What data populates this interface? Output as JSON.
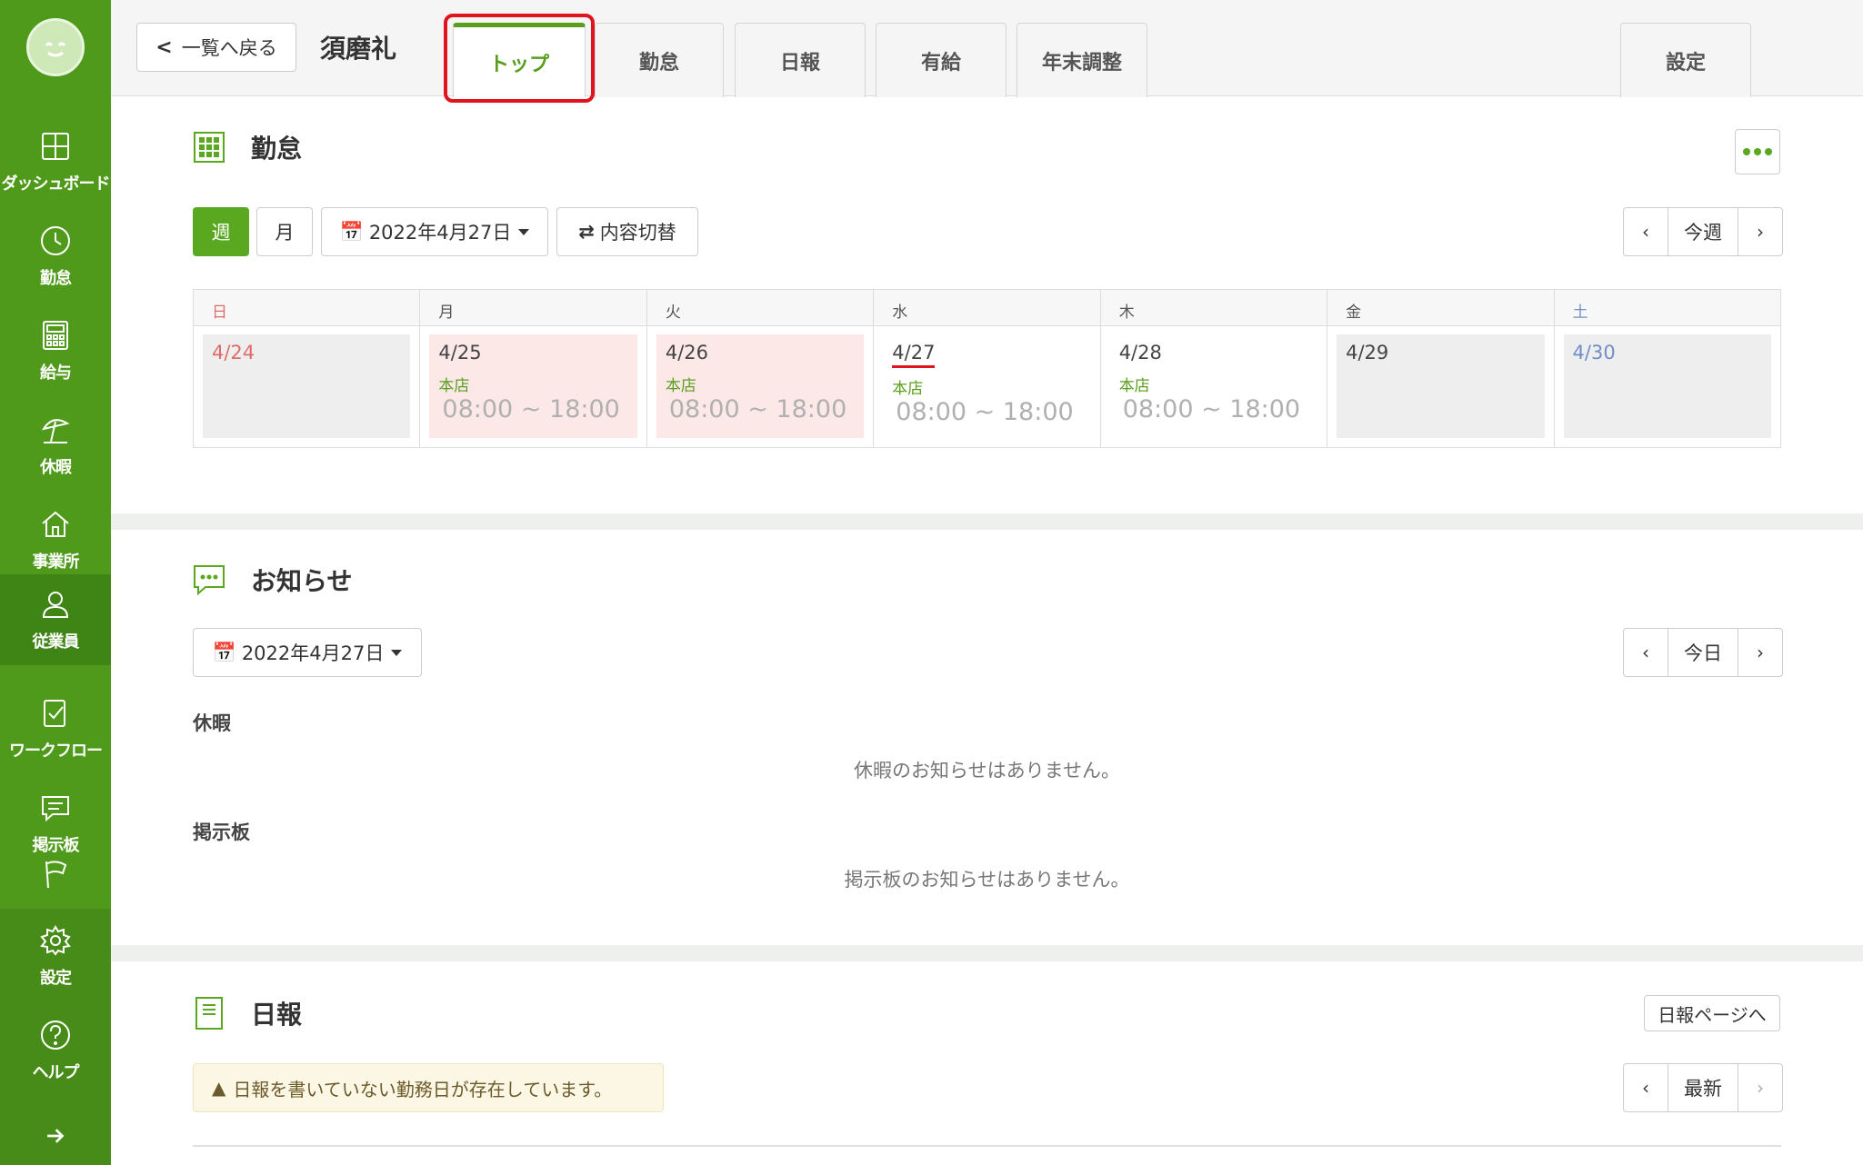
{
  "sidebar": {
    "items": [
      {
        "label": "ダッシュボード",
        "icon": "dashboard-icon"
      },
      {
        "label": "勤怠",
        "icon": "clock-icon"
      },
      {
        "label": "給与",
        "icon": "calculator-icon"
      },
      {
        "label": "休暇",
        "icon": "beach-umbrella-icon"
      },
      {
        "label": "事業所",
        "icon": "home-icon"
      },
      {
        "label": "従業員",
        "icon": "user-icon"
      },
      {
        "label": "ワークフロー",
        "icon": "workflow-check-icon"
      },
      {
        "label": "掲示板",
        "icon": "chat-icon"
      },
      {
        "label": "",
        "icon": "flag-icon"
      },
      {
        "label": "設定",
        "icon": "gear-icon"
      },
      {
        "label": "ヘルプ",
        "icon": "help-icon"
      }
    ]
  },
  "header": {
    "back_label": "一覧へ戻る",
    "employee_name": "須磨礼",
    "tabs": [
      {
        "label": "トップ"
      },
      {
        "label": "勤怠"
      },
      {
        "label": "日報"
      },
      {
        "label": "有給"
      },
      {
        "label": "年末調整"
      },
      {
        "label": "設定"
      }
    ]
  },
  "attendance": {
    "title": "勤怠",
    "view_week": "週",
    "view_month": "月",
    "date_select": "2022年4月27日",
    "toggle_label": "内容切替",
    "nav_current": "今週",
    "weekdays": [
      "日",
      "月",
      "火",
      "水",
      "木",
      "金",
      "土"
    ],
    "days": [
      {
        "date": "4/24",
        "store": "",
        "time": ""
      },
      {
        "date": "4/25",
        "store": "本店",
        "time": "08:00 ~ 18:00"
      },
      {
        "date": "4/26",
        "store": "本店",
        "time": "08:00 ~ 18:00"
      },
      {
        "date": "4/27",
        "store": "本店",
        "time": "08:00 ~ 18:00"
      },
      {
        "date": "4/28",
        "store": "本店",
        "time": "08:00 ~ 18:00"
      },
      {
        "date": "4/29",
        "store": "",
        "time": ""
      },
      {
        "date": "4/30",
        "store": "",
        "time": ""
      }
    ]
  },
  "notices": {
    "title": "お知らせ",
    "date_select": "2022年4月27日",
    "nav_current": "今日",
    "leave_label": "休暇",
    "leave_empty": "休暇のお知らせはありません。",
    "board_label": "掲示板",
    "board_empty": "掲示板のお知らせはありません。"
  },
  "daily_report": {
    "title": "日報",
    "page_link": "日報ページへ",
    "alert": "日報を書いていない勤務日が存在しています。",
    "nav_current": "最新"
  },
  "colors": {
    "sidebar": "#4f9a1b",
    "accent": "#5aa820",
    "highlight": "#e0141e"
  }
}
